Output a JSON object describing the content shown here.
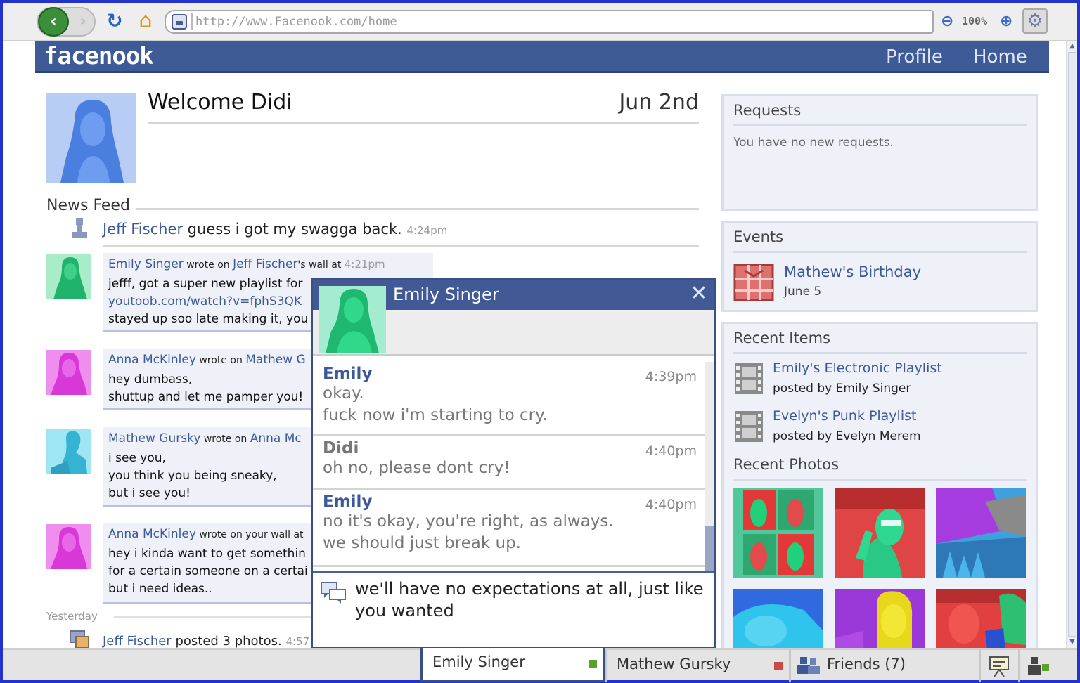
{
  "browser": {
    "url": "http://www.Facenook.com/home",
    "zoom": "100%"
  },
  "site": {
    "logo": "facenook",
    "nav": {
      "profile": "Profile",
      "home": "Home"
    }
  },
  "welcome": {
    "greeting": "Welcome Didi",
    "date": "Jun 2nd"
  },
  "news_feed": {
    "title": "News Feed",
    "status": {
      "author": "Jeff Fischer",
      "text": " guess i got my swagga back. ",
      "time": "4:24pm"
    },
    "posts": [
      {
        "author": "Emily Singer",
        "wrote_on": " wrote on ",
        "target": "Jeff Fischer",
        "suffix": "'s wall at ",
        "time": "4:21pm",
        "line1": "jefff, got a super new playlist for",
        "link": "youtoob.com/watch?v=fphS3QK",
        "line3": "stayed up soo late making it, you"
      },
      {
        "author": "Anna McKinley",
        "wrote_on": " wrote on ",
        "target": "Mathew G",
        "line1": "hey dumbass,",
        "line2": "shuttup and let me pamper you!"
      },
      {
        "author": "Mathew Gursky",
        "wrote_on": " wrote on ",
        "target": "Anna Mc",
        "line1": "i see you,",
        "line2": "you think you being sneaky,",
        "line3": "but i see you!"
      },
      {
        "author": "Anna McKinley",
        "wrote_on": " wrote on your wall at",
        "line1": "hey i kinda want to get somethin",
        "line2": "for a certain someone on a certai",
        "line3": "but i need ideas.."
      }
    ],
    "yesterday_label": "Yesterday",
    "photos_post": {
      "author": "Jeff Fischer",
      "text": " posted 3 photos. ",
      "time": "4:57"
    }
  },
  "sidebar": {
    "requests": {
      "title": "Requests",
      "text": "You have no new requests."
    },
    "events": {
      "title": "Events",
      "name": "Mathew's Birthday",
      "date": "June 5"
    },
    "recent_items": {
      "title": "Recent Items",
      "items": [
        {
          "title": "Emily's Electronic Playlist",
          "sub": "posted by Emily Singer"
        },
        {
          "title": "Evelyn's Punk Playlist",
          "sub": "posted by Evelyn Merem"
        }
      ]
    },
    "recent_photos": {
      "title": "Recent Photos"
    }
  },
  "chat": {
    "name": "Emily Singer",
    "close_icon": "close-icon",
    "messages": [
      {
        "sender": "Emily",
        "time": "4:39pm",
        "line1": "okay.",
        "line2": "fuck now i'm starting to cry."
      },
      {
        "sender": "Didi",
        "time": "4:40pm",
        "line1": "oh no, please dont cry!"
      },
      {
        "sender": "Emily",
        "time": "4:40pm",
        "line1": "no it's okay, you're right, as always.",
        "line2": "we should just break up."
      }
    ],
    "draft_line1": "we'll have no expectations at all, just like",
    "draft_line2": "you wanted"
  },
  "bottom_bar": {
    "tab1": "Emily Singer",
    "tab2": "Mathew Gursky",
    "friends": "Friends (7)"
  },
  "colors": {
    "brand": "#3e5b98",
    "link": "#3b5998",
    "online": "#5aa02c",
    "offline": "#c84a4a"
  }
}
